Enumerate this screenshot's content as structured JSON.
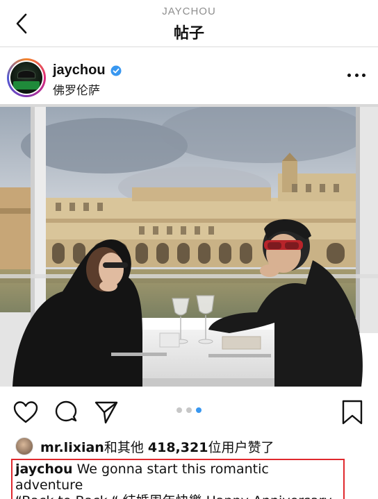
{
  "header": {
    "subtitle": "JAYCHOU",
    "title": "帖子"
  },
  "post": {
    "username": "jaychou",
    "verified": true,
    "location": "佛罗伦萨",
    "carousel": {
      "total": 3,
      "current": 3
    }
  },
  "likes": {
    "liker": "mr.lixian",
    "connector": "和其他",
    "count": "418,321",
    "suffix": "位用户赞了"
  },
  "caption": {
    "username": "jaychou",
    "line1": "We gonna start this romantic adventure",
    "line2": "“Back to Back “ 結婚周年快樂 Happy Anniversary"
  },
  "colors": {
    "accent_blue": "#3897f0",
    "highlight_red": "#e0282d"
  }
}
